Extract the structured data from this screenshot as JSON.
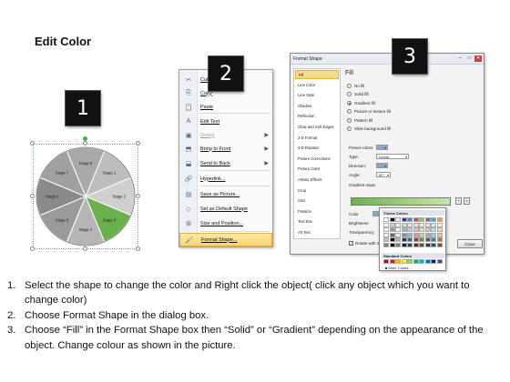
{
  "title": "Edit Color",
  "badges": {
    "one": "1",
    "two": "2",
    "three": "3"
  },
  "pie": {
    "labels": [
      "Stage 8",
      "Stage 1",
      "Stage 2",
      "Stage 3",
      "Stage 4",
      "Stage 5",
      "Stage 6",
      "Stage 7"
    ],
    "highlight_color": "#6ab04c"
  },
  "context_menu": {
    "items": [
      {
        "icon": "cut-icon",
        "label": "Cut",
        "disabled": false,
        "submenu": false
      },
      {
        "icon": "copy-icon",
        "label": "Copy",
        "disabled": false,
        "submenu": false
      },
      {
        "icon": "paste-icon",
        "label": "Paste",
        "disabled": false,
        "submenu": false
      },
      {
        "icon": "edit-text-icon",
        "label": "Edit Text",
        "disabled": false,
        "submenu": false
      },
      {
        "icon": "group-icon",
        "label": "Group",
        "disabled": true,
        "submenu": true
      },
      {
        "icon": "bring-to-front-icon",
        "label": "Bring to Front",
        "disabled": false,
        "submenu": true
      },
      {
        "icon": "send-to-back-icon",
        "label": "Send to Back",
        "disabled": false,
        "submenu": true
      },
      {
        "icon": "hyperlink-icon",
        "label": "Hyperlink...",
        "disabled": false,
        "submenu": false
      },
      {
        "icon": "save-picture-icon",
        "label": "Save as Picture...",
        "disabled": false,
        "submenu": false
      },
      {
        "icon": "default-shape-icon",
        "label": "Set as Default Shape",
        "disabled": false,
        "submenu": false
      },
      {
        "icon": "size-position-icon",
        "label": "Size and Position...",
        "disabled": false,
        "submenu": false
      },
      {
        "icon": "format-shape-icon",
        "label": "Format Shape...",
        "disabled": false,
        "submenu": false
      }
    ]
  },
  "dialog": {
    "title": "Format Shape",
    "nav": [
      "Fill",
      "Line Color",
      "Line Style",
      "Shadow",
      "Reflection",
      "Glow and Soft Edges",
      "3-D Format",
      "3-D Rotation",
      "Picture Corrections",
      "Picture Color",
      "Artistic Effects",
      "Crop",
      "Size",
      "Position",
      "Text Box",
      "Alt Text"
    ],
    "heading": "Fill",
    "fill_options": [
      "No fill",
      "Solid fill",
      "Gradient fill",
      "Picture or texture fill",
      "Pattern fill",
      "Slide background fill"
    ],
    "selected_fill": "Gradient fill",
    "preset_label": "Preset colors:",
    "type_label": "Type:",
    "type_value": "Linear",
    "direction_label": "Direction:",
    "angle_label": "Angle:",
    "angle_value": "90°",
    "stops_label": "Gradient stops",
    "color_label": "Color",
    "position_label": "Position:",
    "position_value": "0%",
    "brightness_label": "Brightness:",
    "transparency_label": "Transparency:",
    "rotate_label": "Rotate with shape",
    "theme_colors_label": "Theme Colors",
    "standard_colors_label": "Standard Colors",
    "more_colors_label": "More Colors...",
    "close_label": "Close",
    "theme_top": [
      "#ffffff",
      "#000000",
      "#eeece1",
      "#1f497d",
      "#4f81bd",
      "#c0504d",
      "#9bbb59",
      "#8064a2",
      "#4bacc6",
      "#f79646"
    ],
    "standard": [
      "#c00000",
      "#ff0000",
      "#ffc000",
      "#ffff00",
      "#92d050",
      "#00b050",
      "#00b0f0",
      "#0070c0",
      "#002060",
      "#7030a0"
    ]
  },
  "instructions": [
    {
      "n": "1.",
      "text": "Select the shape to change the color and Right click the object( click any object which you want to change color)"
    },
    {
      "n": "2.",
      "text": "Choose Format Shape in the dialog box."
    },
    {
      "n": "3.",
      "text": "Choose “Fill” in the Format Shape box then “Solid” or “Gradient” depending on the appearance of the object. Change colour as shown in the picture."
    }
  ]
}
